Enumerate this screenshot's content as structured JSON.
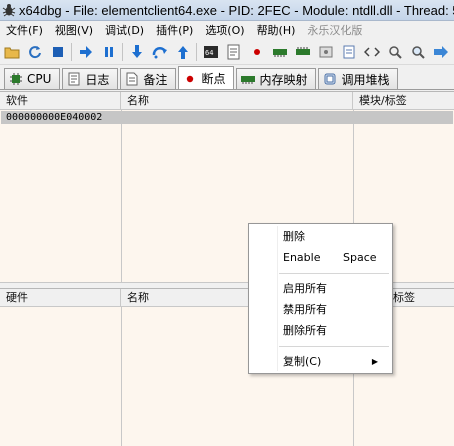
{
  "window": {
    "title": "x64dbg - File: elementclient64.exe - PID: 2FEC - Module: ntdll.dll - Thread: 5"
  },
  "menu": [
    "文件(F)",
    "视图(V)",
    "调试(D)",
    "插件(P)",
    "选项(O)",
    "帮助(H)",
    "永乐汉化版"
  ],
  "toolbar": {
    "icons": [
      "open-icon",
      "restart-icon",
      "stop-icon",
      "run-icon",
      "pause-icon",
      "step-into-icon",
      "step-over-icon",
      "execute-till-return-icon",
      "patch-icon",
      "script-icon",
      "breakpoint-icon",
      "memory-icon",
      "comment-icon",
      "label-icon",
      "bookmark-icon",
      "function-icon",
      "find-icon",
      "zoom-icon",
      "arrow-icon"
    ]
  },
  "tabs": [
    {
      "label": "CPU",
      "icon": "cpu-icon"
    },
    {
      "label": "日志",
      "icon": "log-icon"
    },
    {
      "label": "备注",
      "icon": "notes-icon"
    },
    {
      "label": "断点",
      "icon": "breakpoint-dot-icon",
      "active": true
    },
    {
      "label": "内存映射",
      "icon": "memory-map-icon"
    },
    {
      "label": "调用堆栈",
      "icon": "call-stack-icon"
    }
  ],
  "software_bp": {
    "headers": [
      "软件",
      "名称",
      "模块/标签"
    ],
    "rows": [
      {
        "address": "000000000E040002",
        "name": "",
        "module": ""
      }
    ]
  },
  "hardware_bp": {
    "headers": [
      "硬件",
      "名称",
      "标签"
    ]
  },
  "context_menu": {
    "items": [
      {
        "label": "删除"
      },
      {
        "label": "Enable",
        "shortcut": "Space"
      },
      {
        "label": "启用所有"
      },
      {
        "label": "禁用所有"
      },
      {
        "label": "删除所有"
      },
      {
        "label": "复制(C)",
        "submenu": true
      }
    ]
  },
  "colors": {
    "accent": "#c3d4e9",
    "pane_bg": "#fdf6ee",
    "selected_row": "#c6c6c6",
    "bp_red": "#cc0000"
  }
}
